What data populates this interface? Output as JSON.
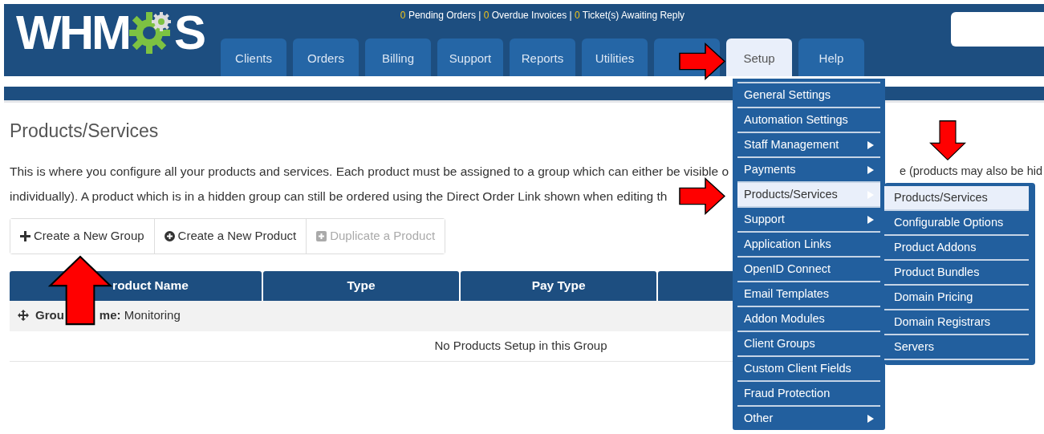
{
  "logo": {
    "text_before": "WHM",
    "text_after": "S"
  },
  "notices": [
    {
      "count": "0",
      "label": "Pending Orders"
    },
    {
      "count": "0",
      "label": "Overdue Invoices"
    },
    {
      "count": "0",
      "label": "Ticket(s) Awaiting Reply"
    }
  ],
  "notice_separator": "|",
  "tabs": [
    {
      "label": "Clients",
      "selected": false
    },
    {
      "label": "Orders",
      "selected": false
    },
    {
      "label": "Billing",
      "selected": false
    },
    {
      "label": "Support",
      "selected": false
    },
    {
      "label": "Reports",
      "selected": false
    },
    {
      "label": "Utilities",
      "selected": false
    },
    {
      "selected": false
    },
    {
      "label": "Setup",
      "selected": true
    },
    {
      "label": "Help",
      "selected": false
    }
  ],
  "page_title": "Products/Services",
  "description": {
    "line_1_left": "This is where you configure all your products and services. Each product must be assigned to a group which can either be visible o",
    "line_1_right": "e (products may also be hid",
    "line_2": "individually). A product which is in a hidden group can still be ordered using the Direct Order Link shown when editing th"
  },
  "actions": [
    {
      "kind": "plus",
      "label": "Create a New Group",
      "disabled": false
    },
    {
      "kind": "circle-plus",
      "label": "Create a New Product",
      "disabled": false
    },
    {
      "kind": "square-plus",
      "label": "Duplicate a Product",
      "disabled": true
    }
  ],
  "table": {
    "columns": [
      "roduct Name",
      "Type",
      "Pay Type"
    ],
    "group_row": {
      "label_start": "Grou",
      "label_end": "me:",
      "value": "Monitoring"
    },
    "empty_message": "No Products Setup in this Group"
  },
  "setup_menu": [
    {
      "label": "General Settings",
      "has_submenu": false,
      "selected": false
    },
    {
      "label": "Automation Settings",
      "has_submenu": false,
      "selected": false
    },
    {
      "label": "Staff Management",
      "has_submenu": true,
      "selected": false
    },
    {
      "label": "Payments",
      "has_submenu": true,
      "selected": false
    },
    {
      "label": "Products/Services",
      "has_submenu": true,
      "selected": true
    },
    {
      "label": "Support",
      "has_submenu": true,
      "selected": false
    },
    {
      "label": "Application Links",
      "has_submenu": false,
      "selected": false
    },
    {
      "label": "OpenID Connect",
      "has_submenu": false,
      "selected": false
    },
    {
      "label": "Email Templates",
      "has_submenu": false,
      "selected": false
    },
    {
      "label": "Addon Modules",
      "has_submenu": false,
      "selected": false
    },
    {
      "label": "Client Groups",
      "has_submenu": false,
      "selected": false
    },
    {
      "label": "Custom Client Fields",
      "has_submenu": false,
      "selected": false
    },
    {
      "label": "Fraud Protection",
      "has_submenu": false,
      "selected": false
    },
    {
      "label": "Other",
      "has_submenu": true,
      "selected": false
    }
  ],
  "submenu": [
    {
      "label": "Products/Services",
      "selected": true
    },
    {
      "label": "Configurable Options",
      "selected": false
    },
    {
      "label": "Product Addons",
      "selected": false
    },
    {
      "label": "Product Bundles",
      "selected": false
    },
    {
      "label": "Domain Pricing",
      "selected": false
    },
    {
      "label": "Domain Registrars",
      "selected": false
    },
    {
      "label": "Servers",
      "selected": false
    }
  ]
}
